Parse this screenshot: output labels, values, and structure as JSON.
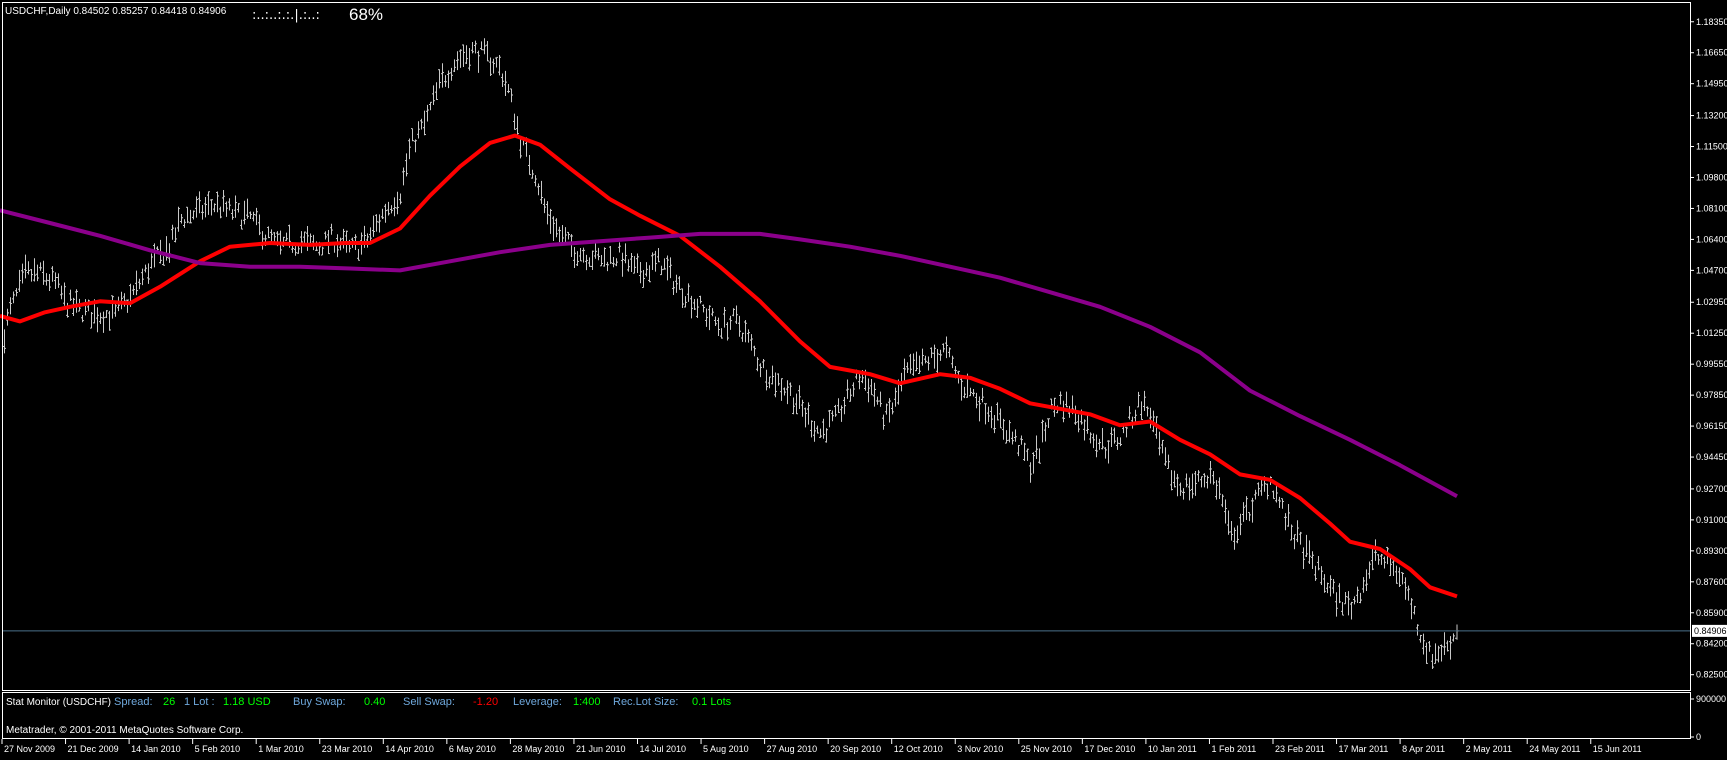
{
  "header": {
    "symbol_ohlc": "USDCHF,Daily  0.84502 0.85257 0.84418 0.84906",
    "strength_dots": ":..:..:.:.|.:..:",
    "strength_pct": "68%"
  },
  "chart_data": {
    "type": "candlestick",
    "symbol": "USDCHF",
    "timeframe": "Daily",
    "ohlc": {
      "open": 0.84502,
      "high": 0.85257,
      "low": 0.84418,
      "close": 0.84906
    },
    "current_price_label": "0.84906",
    "y_ticks": [
      "1.18350",
      "1.16650",
      "1.14950",
      "1.13200",
      "1.11500",
      "1.09800",
      "1.08100",
      "1.06400",
      "1.04700",
      "1.02950",
      "1.01250",
      "0.99550",
      "0.97850",
      "0.96150",
      "0.94450",
      "0.92700",
      "0.91000",
      "0.89300",
      "0.87600",
      "0.85900",
      "0.84200",
      "0.82500"
    ],
    "y_range": [
      0.8166,
      1.1938
    ],
    "subwindow_y_ticks": [
      "900000",
      "0"
    ],
    "x_ticks": [
      "27 Nov 2009",
      "21 Dec 2009",
      "14 Jan 2010",
      "5 Feb 2010",
      "1 Mar 2010",
      "23 Mar 2010",
      "14 Apr 2010",
      "6 May 2010",
      "28 May 2010",
      "21 Jun 2010",
      "14 Jul 2010",
      "5 Aug 2010",
      "27 Aug 2010",
      "20 Sep 2010",
      "12 Oct 2010",
      "3 Nov 2010",
      "25 Nov 2010",
      "17 Dec 2010",
      "10 Jan 2011",
      "1 Feb 2011",
      "23 Feb 2011",
      "17 Mar 2011",
      "8 Apr 2011",
      "2 May 2011",
      "24 May 2011",
      "15 Jun 2011"
    ],
    "price_path": [
      [
        0,
        1.005
      ],
      [
        10,
        1.025
      ],
      [
        25,
        1.045
      ],
      [
        40,
        1.045
      ],
      [
        55,
        1.04
      ],
      [
        65,
        1.03
      ],
      [
        80,
        1.025
      ],
      [
        95,
        1.023
      ],
      [
        115,
        1.023
      ],
      [
        130,
        1.032
      ],
      [
        150,
        1.05
      ],
      [
        170,
        1.06
      ],
      [
        180,
        1.075
      ],
      [
        200,
        1.08
      ],
      [
        215,
        1.083
      ],
      [
        235,
        1.078
      ],
      [
        250,
        1.076
      ],
      [
        265,
        1.066
      ],
      [
        280,
        1.06
      ],
      [
        300,
        1.063
      ],
      [
        318,
        1.06
      ],
      [
        332,
        1.065
      ],
      [
        350,
        1.058
      ],
      [
        365,
        1.062
      ],
      [
        385,
        1.08
      ],
      [
        400,
        1.09
      ],
      [
        410,
        1.115
      ],
      [
        425,
        1.128
      ],
      [
        440,
        1.15
      ],
      [
        455,
        1.162
      ],
      [
        470,
        1.168
      ],
      [
        485,
        1.165
      ],
      [
        500,
        1.158
      ],
      [
        510,
        1.142
      ],
      [
        520,
        1.118
      ],
      [
        535,
        1.1
      ],
      [
        545,
        1.08
      ],
      [
        560,
        1.066
      ],
      [
        575,
        1.058
      ],
      [
        590,
        1.055
      ],
      [
        605,
        1.053
      ],
      [
        620,
        1.055
      ],
      [
        635,
        1.046
      ],
      [
        648,
        1.048
      ],
      [
        660,
        1.052
      ],
      [
        675,
        1.04
      ],
      [
        690,
        1.032
      ],
      [
        705,
        1.024
      ],
      [
        720,
        1.016
      ],
      [
        735,
        1.02
      ],
      [
        745,
        1.012
      ],
      [
        760,
        0.995
      ],
      [
        775,
        0.987
      ],
      [
        790,
        0.98
      ],
      [
        805,
        0.968
      ],
      [
        820,
        0.958
      ],
      [
        835,
        0.965
      ],
      [
        848,
        0.978
      ],
      [
        860,
        0.99
      ],
      [
        872,
        0.982
      ],
      [
        885,
        0.965
      ],
      [
        895,
        0.975
      ],
      [
        905,
        0.99
      ],
      [
        920,
        0.995
      ],
      [
        935,
        1.0
      ],
      [
        945,
        1.003
      ],
      [
        960,
        0.985
      ],
      [
        975,
        0.978
      ],
      [
        990,
        0.97
      ],
      [
        1005,
        0.96
      ],
      [
        1020,
        0.95
      ],
      [
        1030,
        0.94
      ],
      [
        1040,
        0.95
      ],
      [
        1050,
        0.97
      ],
      [
        1060,
        0.975
      ],
      [
        1075,
        0.97
      ],
      [
        1090,
        0.958
      ],
      [
        1105,
        0.95
      ],
      [
        1120,
        0.955
      ],
      [
        1130,
        0.965
      ],
      [
        1140,
        0.975
      ],
      [
        1150,
        0.968
      ],
      [
        1160,
        0.948
      ],
      [
        1170,
        0.935
      ],
      [
        1180,
        0.928
      ],
      [
        1195,
        0.93
      ],
      [
        1210,
        0.935
      ],
      [
        1220,
        0.925
      ],
      [
        1230,
        0.9
      ],
      [
        1245,
        0.912
      ],
      [
        1260,
        0.925
      ],
      [
        1270,
        0.932
      ],
      [
        1280,
        0.918
      ],
      [
        1290,
        0.905
      ],
      [
        1305,
        0.892
      ],
      [
        1320,
        0.88
      ],
      [
        1335,
        0.868
      ],
      [
        1350,
        0.862
      ],
      [
        1360,
        0.872
      ],
      [
        1375,
        0.89
      ],
      [
        1390,
        0.885
      ],
      [
        1400,
        0.88
      ],
      [
        1410,
        0.865
      ],
      [
        1420,
        0.848
      ],
      [
        1430,
        0.835
      ],
      [
        1445,
        0.84
      ],
      [
        1455,
        0.847
      ]
    ],
    "ma_red_path": [
      [
        0,
        1.022
      ],
      [
        20,
        1.019
      ],
      [
        45,
        1.024
      ],
      [
        70,
        1.027
      ],
      [
        100,
        1.03
      ],
      [
        130,
        1.029
      ],
      [
        160,
        1.038
      ],
      [
        200,
        1.052
      ],
      [
        230,
        1.06
      ],
      [
        270,
        1.062
      ],
      [
        310,
        1.061
      ],
      [
        345,
        1.062
      ],
      [
        370,
        1.062
      ],
      [
        400,
        1.07
      ],
      [
        430,
        1.088
      ],
      [
        460,
        1.104
      ],
      [
        490,
        1.117
      ],
      [
        515,
        1.121
      ],
      [
        540,
        1.116
      ],
      [
        570,
        1.103
      ],
      [
        610,
        1.086
      ],
      [
        640,
        1.077
      ],
      [
        680,
        1.066
      ],
      [
        720,
        1.049
      ],
      [
        760,
        1.03
      ],
      [
        800,
        1.008
      ],
      [
        830,
        0.994
      ],
      [
        870,
        0.99
      ],
      [
        900,
        0.985
      ],
      [
        940,
        0.99
      ],
      [
        970,
        0.988
      ],
      [
        1000,
        0.982
      ],
      [
        1030,
        0.974
      ],
      [
        1060,
        0.971
      ],
      [
        1090,
        0.968
      ],
      [
        1120,
        0.962
      ],
      [
        1150,
        0.964
      ],
      [
        1180,
        0.954
      ],
      [
        1210,
        0.946
      ],
      [
        1240,
        0.935
      ],
      [
        1270,
        0.932
      ],
      [
        1300,
        0.922
      ],
      [
        1330,
        0.908
      ],
      [
        1350,
        0.898
      ],
      [
        1380,
        0.894
      ],
      [
        1410,
        0.883
      ],
      [
        1430,
        0.873
      ],
      [
        1457,
        0.868
      ]
    ],
    "ma_purple_path": [
      [
        0,
        1.08
      ],
      [
        50,
        1.073
      ],
      [
        100,
        1.066
      ],
      [
        150,
        1.058
      ],
      [
        200,
        1.051
      ],
      [
        250,
        1.049
      ],
      [
        300,
        1.049
      ],
      [
        350,
        1.048
      ],
      [
        400,
        1.047
      ],
      [
        450,
        1.052
      ],
      [
        500,
        1.057
      ],
      [
        550,
        1.061
      ],
      [
        600,
        1.063
      ],
      [
        650,
        1.065
      ],
      [
        700,
        1.067
      ],
      [
        760,
        1.067
      ],
      [
        800,
        1.064
      ],
      [
        850,
        1.06
      ],
      [
        900,
        1.055
      ],
      [
        950,
        1.049
      ],
      [
        1000,
        1.043
      ],
      [
        1050,
        1.035
      ],
      [
        1100,
        1.027
      ],
      [
        1150,
        1.016
      ],
      [
        1200,
        1.002
      ],
      [
        1250,
        0.981
      ],
      [
        1300,
        0.967
      ],
      [
        1350,
        0.954
      ],
      [
        1400,
        0.94
      ],
      [
        1457,
        0.923
      ]
    ]
  },
  "stat_monitor": {
    "title": "Stat Monitor (USDCHF)",
    "spread_label": "Spread:",
    "spread_value": "26",
    "lot_label": "1 Lot :",
    "lot_value": "1.18 USD",
    "buy_swap_label": "Buy Swap:",
    "buy_swap_value": "0.40",
    "sell_swap_label": "Sell Swap:",
    "sell_swap_value": "-1.20",
    "leverage_label": "Leverage:",
    "leverage_value": "1:400",
    "reclot_label": "Rec.Lot Size:",
    "reclot_value": "0.1 Lots",
    "copyright": "Metatrader, © 2001-2011 MetaQuotes Software Corp."
  },
  "colors": {
    "background": "#000000",
    "bars": "#c8c8c8",
    "ma_fast": "#ff0000",
    "ma_slow": "#8b008b",
    "price_line": "#4a6f8a",
    "axis_text": "#ffffff",
    "label_blue": "#6fa8dc",
    "value_green": "#00ff00",
    "value_red": "#ff0000"
  }
}
